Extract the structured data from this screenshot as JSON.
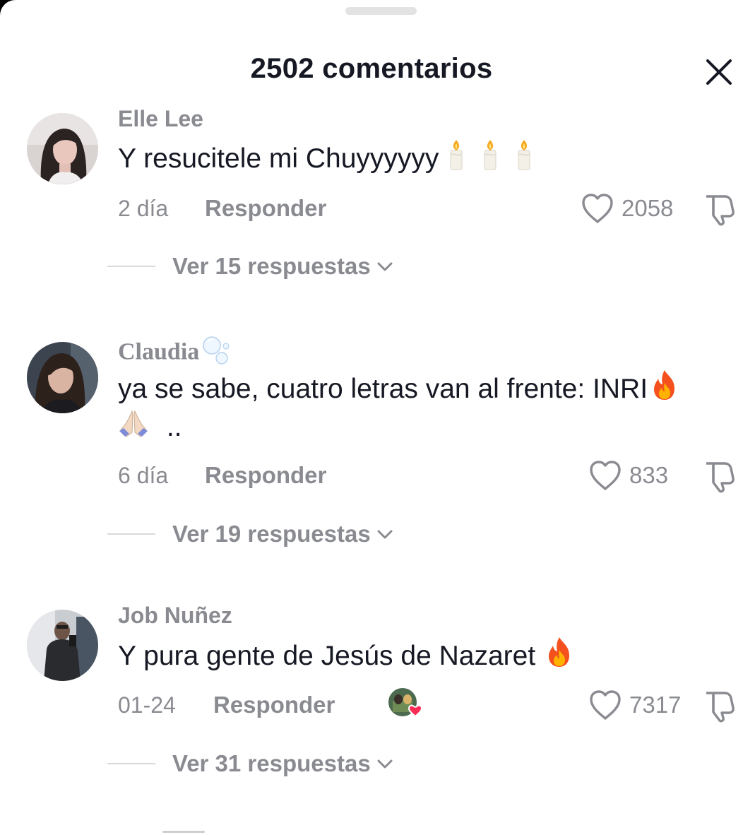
{
  "header": {
    "title": "2502 comentarios"
  },
  "comments": [
    {
      "username": "Elle Lee",
      "text": "Y resucitele mi Chuyyyyyy",
      "time": "2 día",
      "reply_label": "Responder",
      "likes": "2058",
      "view_replies": "Ver 15 respuestas",
      "emojis": [
        "candle",
        "candle",
        "candle"
      ]
    },
    {
      "username": "Claudia",
      "text": "ya se sabe, cuatro letras van al frente: INRI",
      "text_line2": "..",
      "time": "6 día",
      "reply_label": "Responder",
      "likes": "833",
      "view_replies": "Ver 19 respuestas",
      "emojis": [
        "bubbles",
        "fire",
        "folded-hands"
      ]
    },
    {
      "username": "Job Nuñez",
      "text": "Y pura gente de Jesús de Nazaret",
      "time": "01-24",
      "reply_label": "Responder",
      "likes": "7317",
      "view_replies": "Ver 31 respuestas",
      "emojis": [
        "fire"
      ],
      "liked_by_creator": true
    }
  ],
  "icons": {
    "close": "close-icon",
    "like": "heart-outline-icon",
    "dislike": "thumbs-down-icon",
    "expand": "chevron-down-icon"
  },
  "colors": {
    "text_primary": "#161823",
    "text_secondary": "#8a8b91",
    "like_badge": "#fe2c55"
  }
}
